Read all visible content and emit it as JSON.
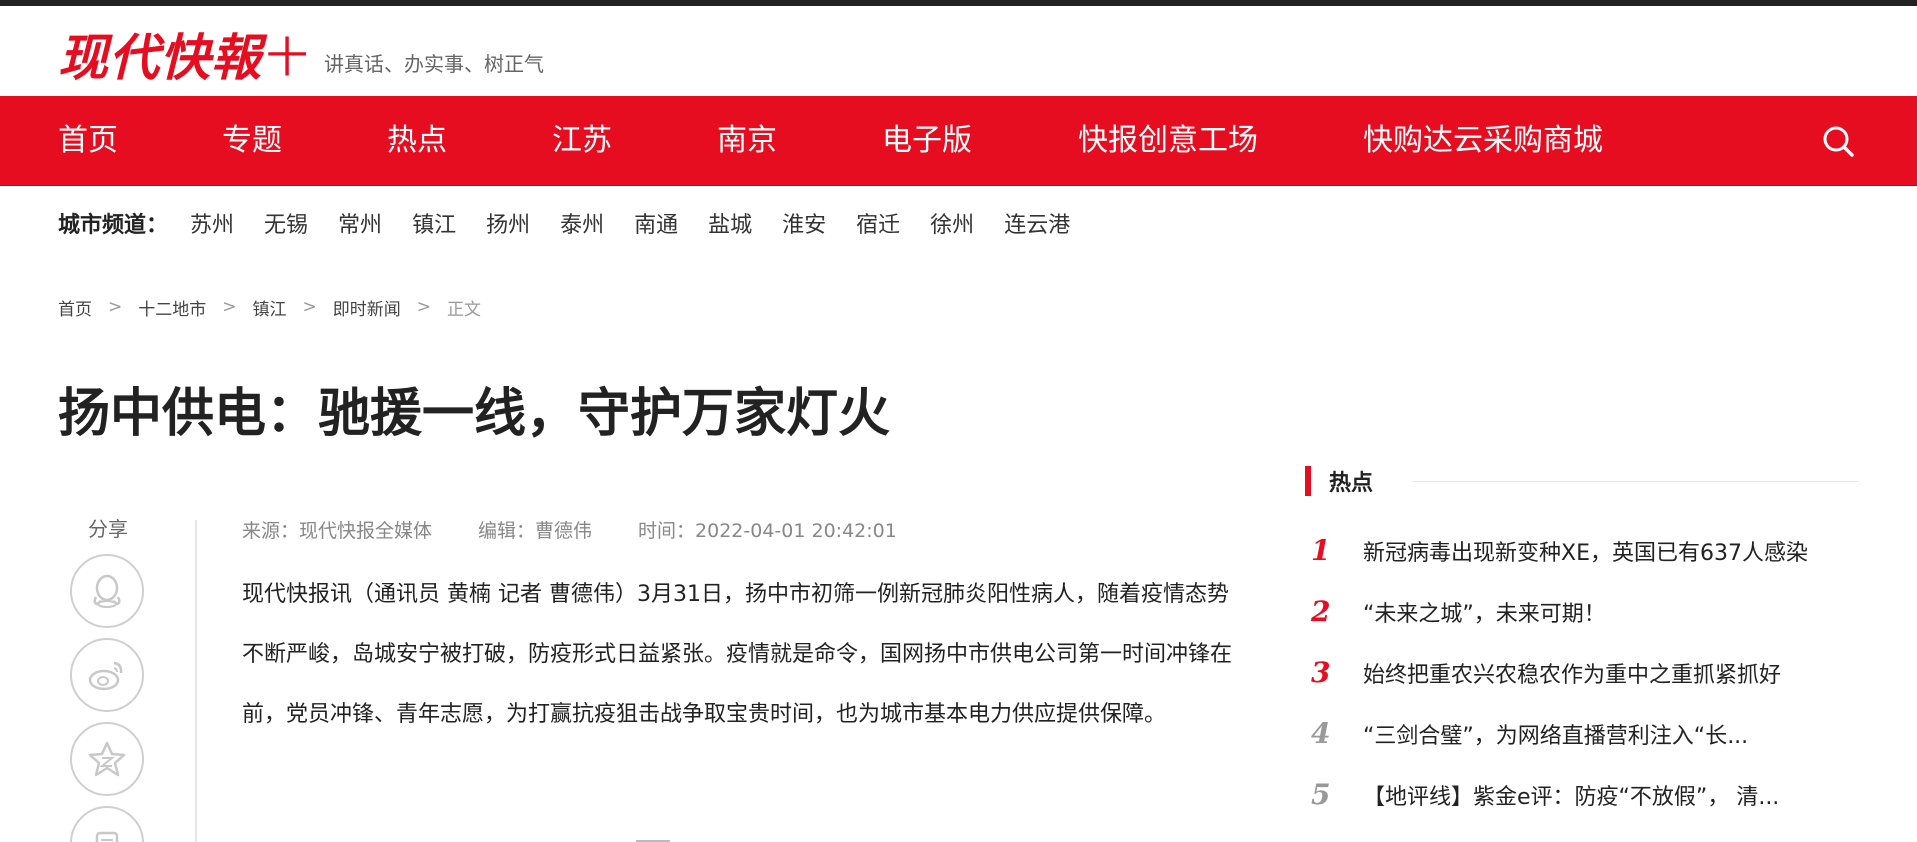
{
  "header": {
    "logo_text": "现代快報",
    "logo_plus": "十",
    "slogan": "讲真话、办实事、树正气"
  },
  "nav": {
    "items": [
      "首页",
      "专题",
      "热点",
      "江苏",
      "南京",
      "电子版",
      "快报创意工场",
      "快购达云采购商城"
    ],
    "search_icon": "search-icon"
  },
  "city_bar": {
    "label": "城市频道：",
    "cities": [
      "苏州",
      "无锡",
      "常州",
      "镇江",
      "扬州",
      "泰州",
      "南通",
      "盐城",
      "淮安",
      "宿迁",
      "徐州",
      "连云港"
    ]
  },
  "breadcrumb": {
    "items": [
      "首页",
      "十二地市",
      "镇江",
      "即时新闻",
      "正文"
    ],
    "separator": ">"
  },
  "article": {
    "title": "扬中供电：驰援一线，守护万家灯火",
    "source": "来源：现代快报全媒体",
    "editor": "编辑：曹德伟",
    "time": "时间：2022-04-01 20:42:01",
    "paragraph": "现代快报讯（通讯员 黄楠 记者 曹德伟）3月31日，扬中市初筛一例新冠肺炎阳性病人，随着疫情态势不断严峻，岛城安宁被打破，防疫形式日益紧张。疫情就是命令，国网扬中市供电公司第一时间冲锋在前，党员冲锋、青年志愿，为打赢抗疫狙击战争取宝贵时间，也为城市基本电力供应提供保障。"
  },
  "share": {
    "label": "分享",
    "icons": [
      "qq-icon",
      "weibo-icon",
      "qzone-icon",
      "wechat-icon"
    ]
  },
  "sidebar": {
    "title": "热点",
    "items": [
      {
        "num": "1",
        "text": "新冠病毒出现新变种XE，英国已有637人感染"
      },
      {
        "num": "2",
        "text": "“未来之城”，未来可期！"
      },
      {
        "num": "3",
        "text": "始终把重农兴农稳农作为重中之重抓紧抓好"
      },
      {
        "num": "4",
        "text": "“三剑合璧”，为网络直播营利注入“长..."
      },
      {
        "num": "5",
        "text": "【地评线】紫金e评：防疫“不放假”， 清..."
      }
    ]
  },
  "colors": {
    "brand_red": "#e60d20"
  }
}
